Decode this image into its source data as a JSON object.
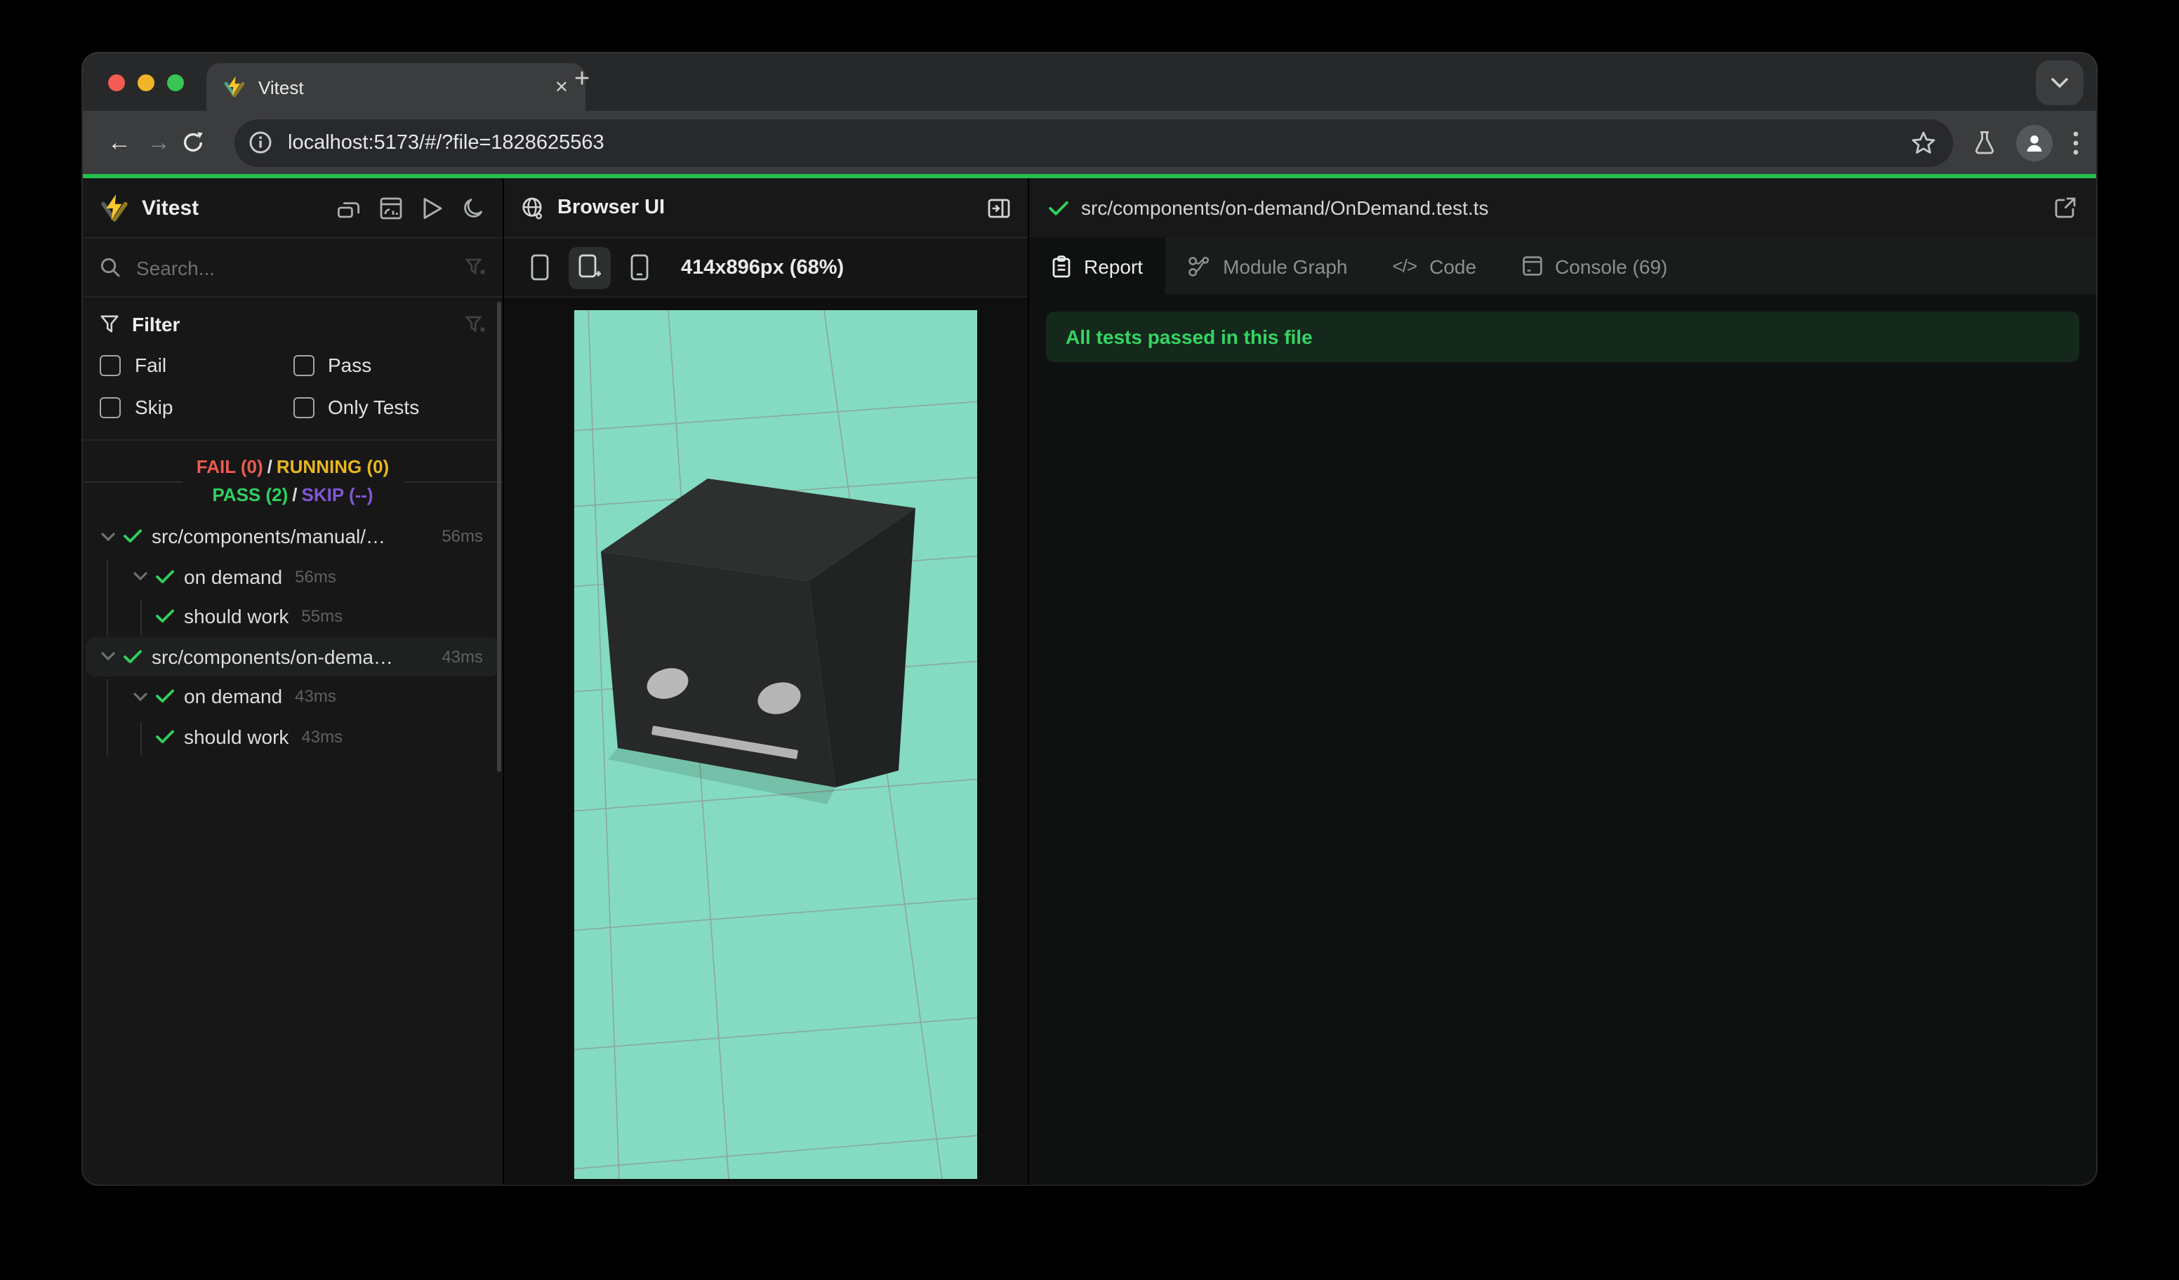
{
  "theme": {
    "accent_green": "#24c14e",
    "status_fail": "#ed5a51",
    "status_running": "#e9b620",
    "status_pass": "#30d15e",
    "status_skip": "#8257d6",
    "mint": "#84dbc1",
    "banner_bg": "#14291c",
    "banner_text": "#35d463"
  },
  "browser": {
    "tab_title": "Vitest",
    "url": "localhost:5173/#/?file=1828625563",
    "close_tab_glyph": "✕",
    "new_tab_glyph": "+",
    "back_glyph": "←",
    "forward_glyph": "→"
  },
  "sidebar": {
    "app_title": "Vitest",
    "search_placeholder": "Search...",
    "filter": {
      "title": "Filter",
      "options": [
        "Fail",
        "Pass",
        "Skip",
        "Only Tests"
      ]
    },
    "status": {
      "fail": "FAIL (0)",
      "running": "RUNNING (0)",
      "pass": "PASS (2)",
      "skip": "SKIP (--)",
      "sep": "/"
    },
    "tree": [
      {
        "label": "src/components/manual/…",
        "duration": "56ms"
      },
      {
        "label": "on demand",
        "duration": "56ms"
      },
      {
        "label": "should work",
        "duration": "55ms"
      },
      {
        "label": "src/components/on-dema…",
        "duration": "43ms"
      },
      {
        "label": "on demand",
        "duration": "43ms"
      },
      {
        "label": "should work",
        "duration": "43ms"
      }
    ]
  },
  "preview": {
    "title": "Browser UI",
    "dimensions": "414x896px (68%)"
  },
  "report": {
    "file_path": "src/components/on-demand/OnDemand.test.ts",
    "tabs": [
      "Report",
      "Module Graph",
      "Code",
      "Console (69)"
    ],
    "banner": "All tests passed in this file"
  }
}
